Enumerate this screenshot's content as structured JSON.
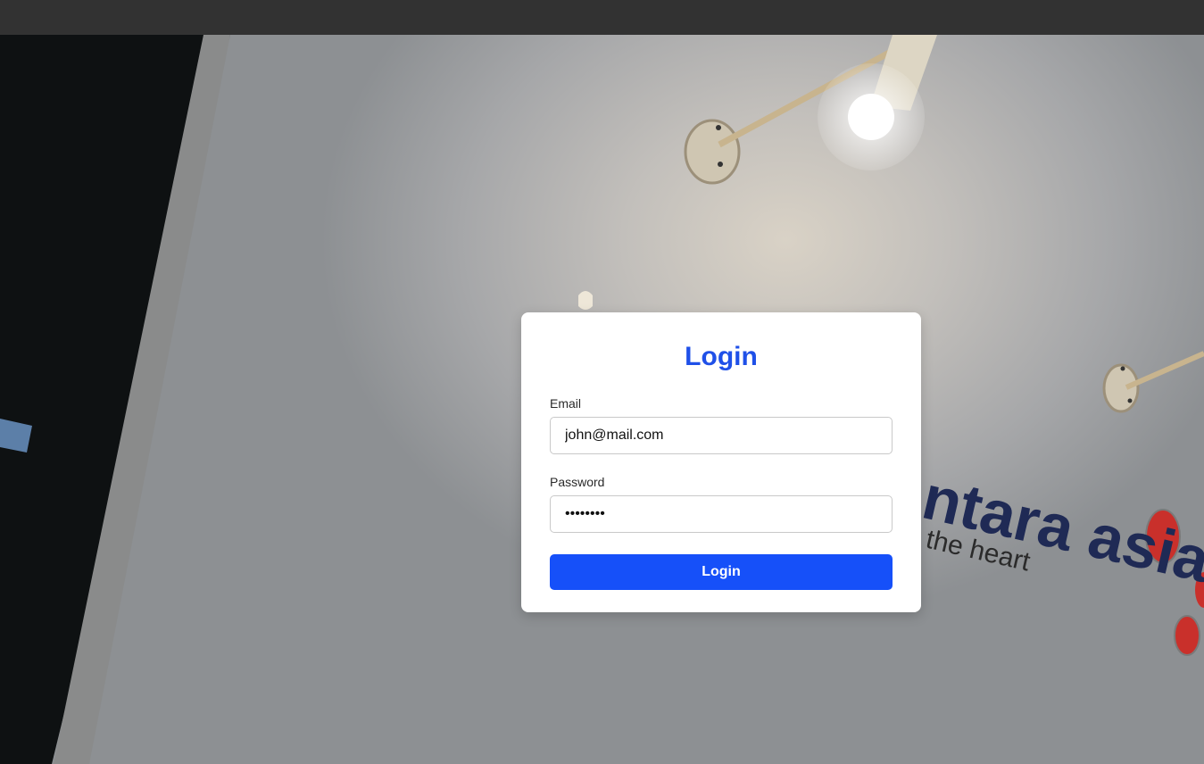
{
  "login": {
    "title": "Login",
    "email_label": "Email",
    "email_value": "john@mail.com",
    "password_label": "Password",
    "password_value": "password",
    "submit_label": "Login"
  },
  "background": {
    "wall_sign_line1": "ntara asia",
    "wall_sign_line2": "the heart"
  },
  "colors": {
    "accent": "#1650f9",
    "title": "#1f50e8",
    "topbar": "#323232"
  }
}
